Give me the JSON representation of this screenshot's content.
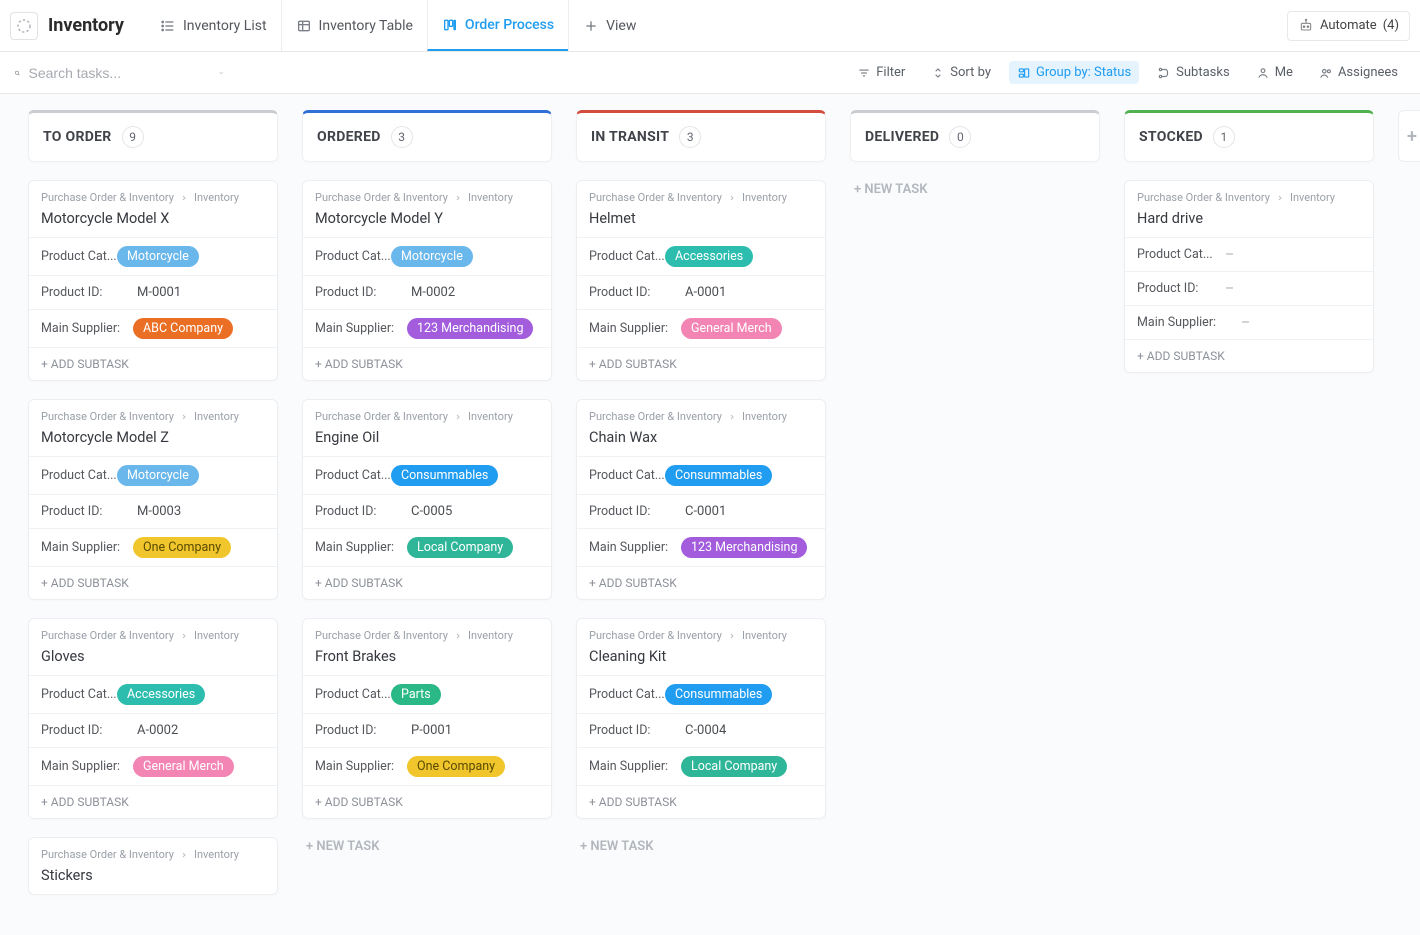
{
  "header": {
    "title": "Inventory",
    "views": [
      {
        "label": "Inventory List",
        "kind": "list",
        "active": false
      },
      {
        "label": "Inventory Table",
        "kind": "table",
        "active": false
      },
      {
        "label": "Order Process",
        "kind": "board",
        "active": true
      },
      {
        "label": "View",
        "kind": "add",
        "active": false
      }
    ],
    "automate_label": "Automate",
    "automate_count": "(4)"
  },
  "filterbar": {
    "search_placeholder": "Search tasks...",
    "filter": "Filter",
    "sort": "Sort by",
    "group": "Group by: Status",
    "subtasks": "Subtasks",
    "me": "Me",
    "assignees": "Assignees"
  },
  "breadcrumb": {
    "root": "Purchase Order & Inventory",
    "leaf": "Inventory"
  },
  "labels": {
    "product_cat": "Product Cat...",
    "product_id": "Product ID:",
    "main_supplier": "Main Supplier:",
    "add_subtask": "+ ADD SUBTASK",
    "new_task": "+  NEW TASK"
  },
  "colors": {
    "motorcycle": "#6ab7ec",
    "accessories": "#2cbdaf",
    "consummables": "#209cf0",
    "parts": "#2ab887",
    "abc_company": "#ea6f24",
    "one_company": "#f0c62c",
    "local_company": "#2fb598",
    "general_merch": "#f385b4",
    "merch_123": "#a25cdc"
  },
  "columns": [
    {
      "name": "TO ORDER",
      "count": "9",
      "color": "#c9ccd0",
      "cards": [
        {
          "title": "Motorcycle Model X",
          "cat": "Motorcycle",
          "cat_color": "motorcycle",
          "pid": "M-0001",
          "supplier": "ABC Company",
          "sup_color": "abc_company"
        },
        {
          "title": "Motorcycle Model Z",
          "cat": "Motorcycle",
          "cat_color": "motorcycle",
          "pid": "M-0003",
          "supplier": "One Company",
          "sup_color": "one_company"
        },
        {
          "title": "Gloves",
          "cat": "Accessories",
          "cat_color": "accessories",
          "pid": "A-0002",
          "supplier": "General Merch",
          "sup_color": "general_merch"
        },
        {
          "title": "Stickers",
          "partial": true
        }
      ],
      "show_new_task": false
    },
    {
      "name": "ORDERED",
      "count": "3",
      "color": "#2f6fd6",
      "cards": [
        {
          "title": "Motorcycle Model Y",
          "cat": "Motorcycle",
          "cat_color": "motorcycle",
          "pid": "M-0002",
          "supplier": "123 Merchandising",
          "sup_color": "merch_123"
        },
        {
          "title": "Engine Oil",
          "cat": "Consummables",
          "cat_color": "consummables",
          "pid": "C-0005",
          "supplier": "Local Company",
          "sup_color": "local_company"
        },
        {
          "title": "Front Brakes",
          "cat": "Parts",
          "cat_color": "parts",
          "pid": "P-0001",
          "supplier": "One Company",
          "sup_color": "one_company"
        }
      ],
      "show_new_task": true
    },
    {
      "name": "IN TRANSIT",
      "count": "3",
      "color": "#d44c3d",
      "cards": [
        {
          "title": "Helmet",
          "cat": "Accessories",
          "cat_color": "accessories",
          "pid": "A-0001",
          "supplier": "General Merch",
          "sup_color": "general_merch"
        },
        {
          "title": "Chain Wax",
          "cat": "Consummables",
          "cat_color": "consummables",
          "pid": "C-0001",
          "supplier": "123 Merchandising",
          "sup_color": "merch_123"
        },
        {
          "title": "Cleaning Kit",
          "cat": "Consummables",
          "cat_color": "consummables",
          "pid": "C-0004",
          "supplier": "Local Company",
          "sup_color": "local_company"
        }
      ],
      "show_new_task": true
    },
    {
      "name": "DELIVERED",
      "count": "0",
      "color": "#c9ccd0",
      "cards": [],
      "show_new_task": true
    },
    {
      "name": "STOCKED",
      "count": "1",
      "color": "#4fb24f",
      "cards": [
        {
          "title": "Hard drive",
          "empty": true
        }
      ],
      "show_new_task": false
    }
  ]
}
